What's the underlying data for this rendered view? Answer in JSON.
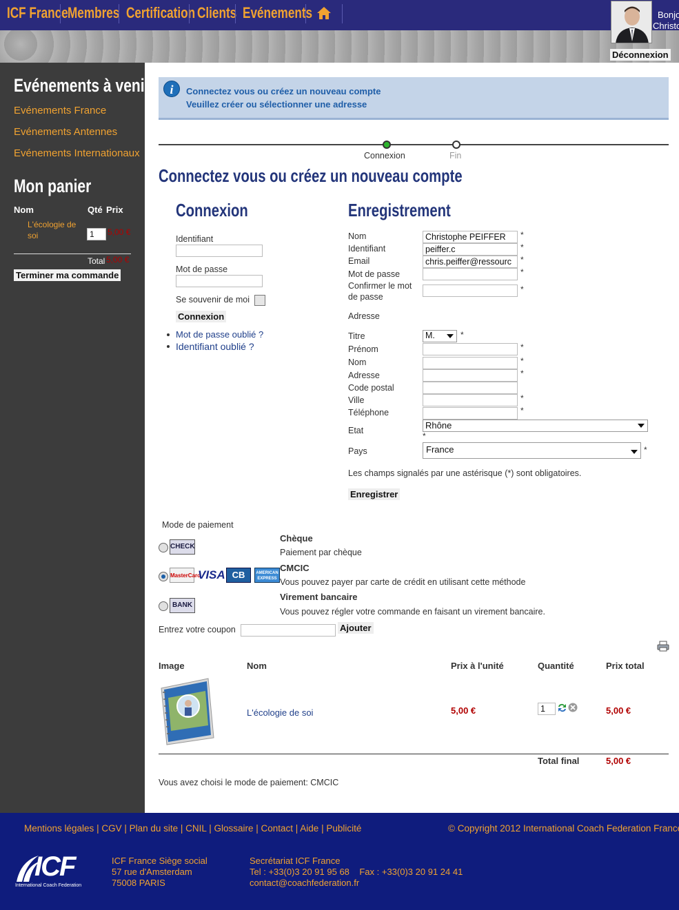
{
  "nav": {
    "items": [
      "ICF France",
      "Membres",
      "Certification",
      "Clients",
      "Evénements"
    ],
    "home_icon": "home-icon",
    "greeting": "Bonjour",
    "user_short": "Christo",
    "logout": "Déconnexion"
  },
  "sidebar": {
    "events_title": "Evénements à venir",
    "event_links": [
      "Evénements France",
      "Evénements Antennes",
      "Evénements Internationaux"
    ],
    "cart_title": "Mon panier",
    "cart_headers": {
      "name": "Nom",
      "qty": "Qté",
      "price": "Prix"
    },
    "cart_item": {
      "name_line1": "L'écologie de",
      "name_line2": "soi",
      "qty": "1",
      "price": "5,00 €"
    },
    "total_label": "Total",
    "total_value": "5,00 €",
    "checkout_button": "Terminer ma commande"
  },
  "info": {
    "line1": "Connectez vous ou créez un nouveau compte",
    "line2": "Veuillez créer ou sélectionner une adresse"
  },
  "steps": {
    "step1": "Connexion",
    "step2": "Fin"
  },
  "page_title": "Connectez vous ou créez un nouveau compte",
  "login": {
    "title": "Connexion",
    "username_label": "Identifiant",
    "password_label": "Mot de passe",
    "remember_label": "Se souvenir de moi",
    "submit": "Connexion",
    "forgot_password": "Mot de passe oublié ?",
    "forgot_username": "Identifiant oublié ?"
  },
  "register": {
    "title": "Enregistrement",
    "name_label": "Nom",
    "name_value": "Christophe PEIFFER",
    "username_label": "Identifiant",
    "username_value": "peiffer.c",
    "email_label": "Email",
    "email_value": "chris.peiffer@ressourc",
    "password_label": "Mot de passe",
    "confirm_label_1": "Confirmer le mot",
    "confirm_label_2": "de passe",
    "address_section": "Adresse",
    "title_label": "Titre",
    "title_value": "M.",
    "firstname_label": "Prénom",
    "lastname_label": "Nom",
    "address_label": "Adresse",
    "zip_label": "Code postal",
    "city_label": "Ville",
    "phone_label": "Téléphone",
    "state_label": "Etat",
    "state_value": "Rhône",
    "country_label": "Pays",
    "country_value": "France",
    "required_note": "Les champs signalés par une astérisque (*) sont obligatoires.",
    "submit": "Enregistrer",
    "asterisk": "*"
  },
  "payment": {
    "title": "Mode de paiement",
    "methods": [
      {
        "name": "Chèque",
        "desc": "Paiement par chèque",
        "logo": "CHECK",
        "selected": false
      },
      {
        "name": "CMCIC",
        "desc": "Vous pouvez payer par carte de crédit en utilisant cette méthode",
        "logos": [
          "MasterCard",
          "VISA",
          "CB",
          "AMERICAN EXPRESS"
        ],
        "selected": true
      },
      {
        "name": "Virement bancaire",
        "desc": "Vous pouvez régler votre commande en faisant un virement bancaire.",
        "logo": "BANK",
        "selected": false
      }
    ]
  },
  "coupon": {
    "label": "Entrez votre coupon",
    "button": "Ajouter"
  },
  "cart": {
    "headers": [
      "Image",
      "Nom",
      "Prix à l'unité",
      "Quantité",
      "Prix total"
    ],
    "row": {
      "name": "L'écologie de soi",
      "unit_price": "5,00 €",
      "qty": "1",
      "total": "5,00 €"
    },
    "total_label": "Total final",
    "total_value": "5,00 €",
    "chosen": "Vous avez choisi le mode de paiement: CMCIC"
  },
  "footer": {
    "links": [
      "Mentions légales",
      "CGV",
      "Plan du site",
      "CNIL",
      "Glossaire",
      "Contact",
      "Aide",
      "Publicité"
    ],
    "copyright": "© Copyright 2012 International Coach Federation France",
    "logo_text": "ICF",
    "logo_sub": "International Coach Federation",
    "office": [
      "ICF France Siège social",
      "57 rue d'Amsterdam",
      "75008 PARIS"
    ],
    "secretariat": [
      "Secrétariat ICF France",
      "Tel : +33(0)3 20 91 95 68    Fax : +33(0)3 20 91 24 41",
      "contact@coachfederation.fr"
    ]
  },
  "colors": {
    "nav_bg": "#2a2a7c",
    "accent": "#f0a231",
    "sidebar_bg": "#3c3c3c",
    "footer_bg": "#0f1c7d",
    "price_red": "#b10000",
    "heading_blue": "#23357a"
  }
}
